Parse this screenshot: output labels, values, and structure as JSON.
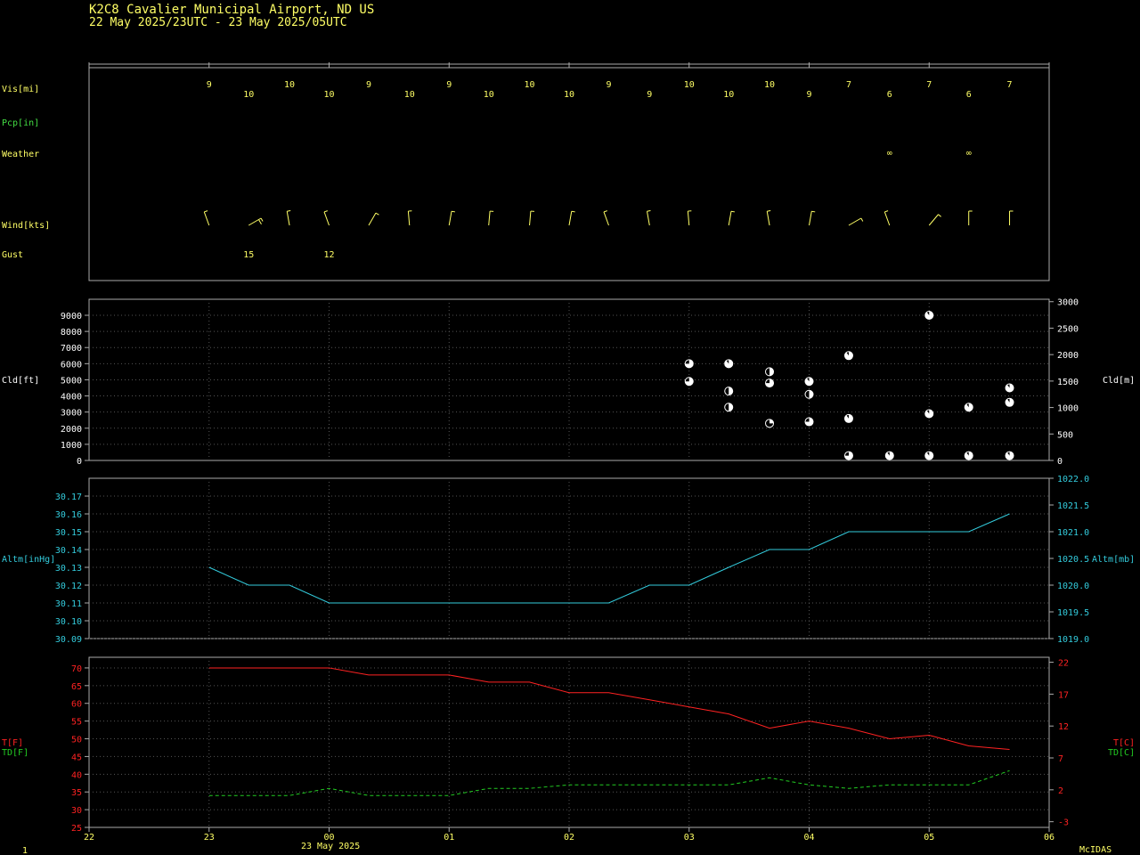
{
  "header": {
    "station": "K2C8  Cavalier Municipal Airport, ND US",
    "period": "22 May 2025/23UTC - 23 May 2025/05UTC"
  },
  "footer": {
    "left_number": "1",
    "date_label": "23 May 2025",
    "credit": "McIDAS"
  },
  "colors": {
    "text_yellow": "#ffff66",
    "frame": "#aaaaaa",
    "grid": "#555555",
    "precip_green": "#44dd44",
    "cyan": "#33ccdd",
    "temp_red": "#ff2222",
    "dewpoint_green": "#22cc22",
    "cloud_white": "#ffffff"
  },
  "chart_data": [
    {
      "type": "table",
      "panel": "surface-obs",
      "row_labels": {
        "vis": "Vis[mi]",
        "pcp": "Pcp[in]",
        "weather": "Weather",
        "wind": "Wind[kts]",
        "gust": "Gust"
      },
      "times": [
        23.0,
        23.33,
        23.67,
        0.0,
        0.33,
        0.67,
        1.0,
        1.33,
        1.67,
        2.0,
        2.33,
        2.67,
        3.0,
        3.33,
        3.67,
        4.0,
        4.33,
        4.67,
        5.0,
        5.33,
        5.67
      ],
      "visibility": [
        "9",
        "10",
        "10",
        "10",
        "9",
        "10",
        "9",
        "10",
        "10",
        "10",
        "9",
        "9",
        "10",
        "10",
        "10",
        "9",
        "7",
        "6",
        "7",
        "6",
        "7"
      ],
      "weather": [
        "",
        "",
        "",
        "",
        "",
        "",
        "",
        "",
        "",
        "",
        "",
        "",
        "",
        "",
        "",
        "",
        "",
        "∞",
        "",
        "∞",
        ""
      ],
      "wind_dir_deg": [
        340,
        60,
        350,
        340,
        30,
        355,
        10,
        5,
        5,
        10,
        340,
        350,
        355,
        10,
        350,
        10,
        60,
        340,
        40,
        0,
        0
      ],
      "wind_speed_kts": [
        5,
        10,
        5,
        5,
        5,
        5,
        5,
        5,
        5,
        5,
        5,
        5,
        5,
        5,
        5,
        5,
        5,
        5,
        5,
        5,
        5
      ],
      "gust": [
        "",
        "15",
        "",
        "12",
        "",
        "",
        "",
        "",
        "",
        "",
        "",
        "",
        "",
        "",
        "",
        "",
        "",
        "",
        "",
        "",
        ""
      ]
    },
    {
      "type": "scatter",
      "panel": "cloud",
      "ylabel_left": "Cld[ft]",
      "ylabel_right": "Cld[m]",
      "ylim_ft": [
        0,
        9000
      ],
      "ylim_m": [
        0,
        3000
      ],
      "ticks_left": [
        "0",
        "1000",
        "2000",
        "3000",
        "4000",
        "5000",
        "6000",
        "7000",
        "8000",
        "9000"
      ],
      "ticks_right": [
        "0",
        "500",
        "1000",
        "1500",
        "2000",
        "2500",
        "3000"
      ],
      "points": [
        {
          "t": 3.0,
          "ft": 6000,
          "cover": "BKN"
        },
        {
          "t": 3.0,
          "ft": 4900,
          "cover": "BKN"
        },
        {
          "t": 3.33,
          "ft": 6000,
          "cover": "OVC"
        },
        {
          "t": 3.33,
          "ft": 4300,
          "cover": "SCT"
        },
        {
          "t": 3.33,
          "ft": 3300,
          "cover": "SCT"
        },
        {
          "t": 3.67,
          "ft": 5500,
          "cover": "SCT"
        },
        {
          "t": 3.67,
          "ft": 4800,
          "cover": "BKN"
        },
        {
          "t": 3.67,
          "ft": 2300,
          "cover": "FEW"
        },
        {
          "t": 4.0,
          "ft": 4900,
          "cover": "OVC"
        },
        {
          "t": 4.0,
          "ft": 4100,
          "cover": "SCT"
        },
        {
          "t": 4.0,
          "ft": 2400,
          "cover": "BKN"
        },
        {
          "t": 4.33,
          "ft": 6500,
          "cover": "OVC"
        },
        {
          "t": 4.33,
          "ft": 2600,
          "cover": "OVC"
        },
        {
          "t": 4.33,
          "ft": 300,
          "cover": "BKN"
        },
        {
          "t": 4.67,
          "ft": 300,
          "cover": "OVC"
        },
        {
          "t": 5.0,
          "ft": 9000,
          "cover": "OVC"
        },
        {
          "t": 5.0,
          "ft": 2900,
          "cover": "OVC"
        },
        {
          "t": 5.0,
          "ft": 300,
          "cover": "OVC"
        },
        {
          "t": 5.33,
          "ft": 3300,
          "cover": "OVC"
        },
        {
          "t": 5.33,
          "ft": 300,
          "cover": "OVC"
        },
        {
          "t": 5.67,
          "ft": 4500,
          "cover": "OVC"
        },
        {
          "t": 5.67,
          "ft": 3600,
          "cover": "OVC"
        },
        {
          "t": 5.67,
          "ft": 300,
          "cover": "OVC"
        }
      ]
    },
    {
      "type": "line",
      "panel": "altimeter",
      "ylabel_left": "Altm[inHg]",
      "ylabel_right": "Altm[mb]",
      "ylim_inhg": [
        30.09,
        30.18
      ],
      "ylim_mb": [
        1019.0,
        1022.0
      ],
      "ticks_left": [
        "30.09",
        "30.10",
        "30.11",
        "30.12",
        "30.13",
        "30.14",
        "30.15",
        "30.16",
        "30.17"
      ],
      "ticks_right": [
        "1019.0",
        "1019.5",
        "1020.0",
        "1020.5",
        "1021.0",
        "1021.5",
        "1022.0"
      ],
      "series": [
        {
          "x": [
            23.0,
            23.33,
            23.67,
            0.0,
            0.33,
            0.67,
            1.0,
            1.33,
            1.67,
            2.0,
            2.33,
            2.67,
            3.0,
            3.33,
            3.67,
            4.0,
            4.33,
            4.67,
            5.0,
            5.33,
            5.67
          ],
          "values": [
            30.13,
            30.12,
            30.12,
            30.11,
            30.11,
            30.11,
            30.11,
            30.11,
            30.11,
            30.11,
            30.11,
            30.12,
            30.12,
            30.13,
            30.14,
            30.14,
            30.15,
            30.15,
            30.15,
            30.15,
            30.16
          ]
        }
      ]
    },
    {
      "type": "line",
      "panel": "temperature",
      "ylabel_left": [
        "T[F]",
        "TD[F]"
      ],
      "ylabel_right": [
        "T[C]",
        "TD[C]"
      ],
      "ylim_f": [
        25,
        73
      ],
      "ticks_left": [
        "25",
        "30",
        "35",
        "40",
        "45",
        "50",
        "55",
        "60",
        "65",
        "70"
      ],
      "ticks_right": [
        "-3",
        "2",
        "7",
        "12",
        "17",
        "22"
      ],
      "series": [
        {
          "key": "T",
          "x": [
            23.0,
            23.33,
            23.67,
            0.0,
            0.33,
            0.67,
            1.0,
            1.33,
            1.67,
            2.0,
            2.33,
            2.67,
            3.0,
            3.33,
            3.67,
            4.0,
            4.33,
            4.67,
            5.0,
            5.33,
            5.67
          ],
          "values": [
            70,
            70,
            70,
            70,
            68,
            68,
            68,
            66,
            66,
            63,
            63,
            61,
            59,
            57,
            53,
            55,
            53,
            50,
            51,
            48,
            47
          ]
        },
        {
          "key": "TD",
          "x": [
            23.0,
            23.33,
            23.67,
            0.0,
            0.33,
            0.67,
            1.0,
            1.33,
            1.67,
            2.0,
            2.33,
            2.67,
            3.0,
            3.33,
            3.67,
            4.0,
            4.33,
            4.67,
            5.0,
            5.33,
            5.67
          ],
          "values": [
            34,
            34,
            34,
            36,
            34,
            34,
            34,
            36,
            36,
            37,
            37,
            37,
            37,
            37,
            39,
            37,
            36,
            37,
            37,
            37,
            41
          ]
        }
      ],
      "x_ticks": [
        "22",
        "23",
        "00",
        "01",
        "02",
        "03",
        "04",
        "05",
        "06"
      ]
    }
  ]
}
